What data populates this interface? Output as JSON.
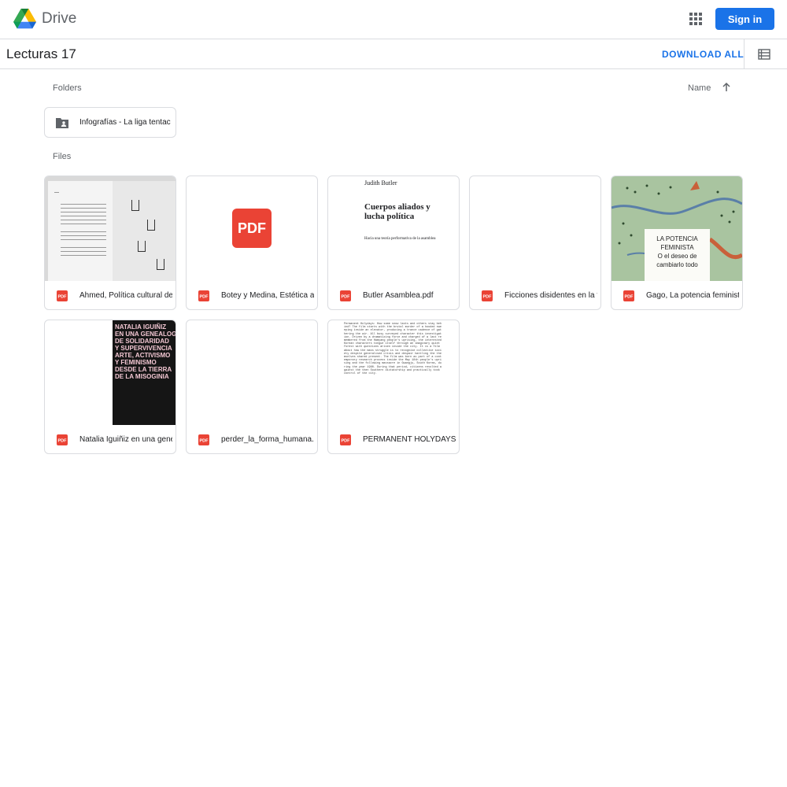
{
  "header": {
    "brand": "Drive",
    "sign_in_label": "Sign in"
  },
  "subheader": {
    "folder_title": "Lecturas 17",
    "download_all_label": "DOWNLOAD ALL"
  },
  "folders_section": {
    "label": "Folders",
    "sort_label": "Name",
    "items": [
      {
        "name": "Infografías - La liga tentacular"
      }
    ]
  },
  "files_section": {
    "label": "Files",
    "items": [
      {
        "name": "Ahmed, Política cultural de las emociones.pdf",
        "thumb": "ahmed"
      },
      {
        "name": "Botey y Medina, Estética acontecimiento.pdf",
        "thumb": "pdf-icon"
      },
      {
        "name": "Butler Asamblea.pdf",
        "thumb": "butler"
      },
      {
        "name": "Ficciones disidentes en la tierra de la misoginia.pdf",
        "thumb": "blank"
      },
      {
        "name": "Gago, La potencia feminista.pdf",
        "thumb": "gago"
      },
      {
        "name": "Natalia Iguiñiz en una genealogía.pdf",
        "thumb": "natalia"
      },
      {
        "name": "perder_la_forma_humana.pdf",
        "thumb": "blank"
      },
      {
        "name": "PERMANENT HOLYDAYS.pdf",
        "thumb": "permanent"
      }
    ]
  },
  "thumbnails": {
    "pdf_icon_text": "PDF",
    "butler_author": "Judith Butler",
    "butler_title": "Cuerpos aliados y lucha política",
    "butler_subtitle": "Hacia una teoría performativa de la asamblea",
    "gago_title": "LA POTENCIA FEMINISTA",
    "gago_subtitle": "O el deseo de cambiarlo todo",
    "natalia_title_lines": [
      "NATALIA IGUIÑIZ",
      "EN UNA GENEALOG",
      "DE SOLIDARIDAD",
      "Y SUPERVIVENCIA",
      "ARTE, ACTIVISMO",
      "Y FEMINISMO",
      "DESDE LA TIERRA",
      "DE LA MISOGINIA"
    ],
    "permanent_text": "Permanent Holydays: How some snow lasts and others stay behind? The film starts with the brutal murder of a hooded sweeping inside an elevator, producing a trance cadence of gathering the air. All busy surveyed character this investigation. Driven by a dramatizing force and charged of a last remembered from the Hamyang people's uprising, the interested Korean characters tongue itself through an imaginary quiet forest with questions arisen inside the city. It is a film about how the mass struggle is to recognise collective society despite generalised crisis and despair battling the themselves shared present. The film was born as part of a contemporary research process inside the May 18th people's uprising and the following massacre in Gwangju, South Korea, during the year 1980. During that period, citizens revolted against the then Southern dictatorship and practically took control of the city."
  },
  "colors": {
    "accent": "#1a73e8",
    "pdf_red": "#ea4335",
    "border": "#dadce0"
  }
}
